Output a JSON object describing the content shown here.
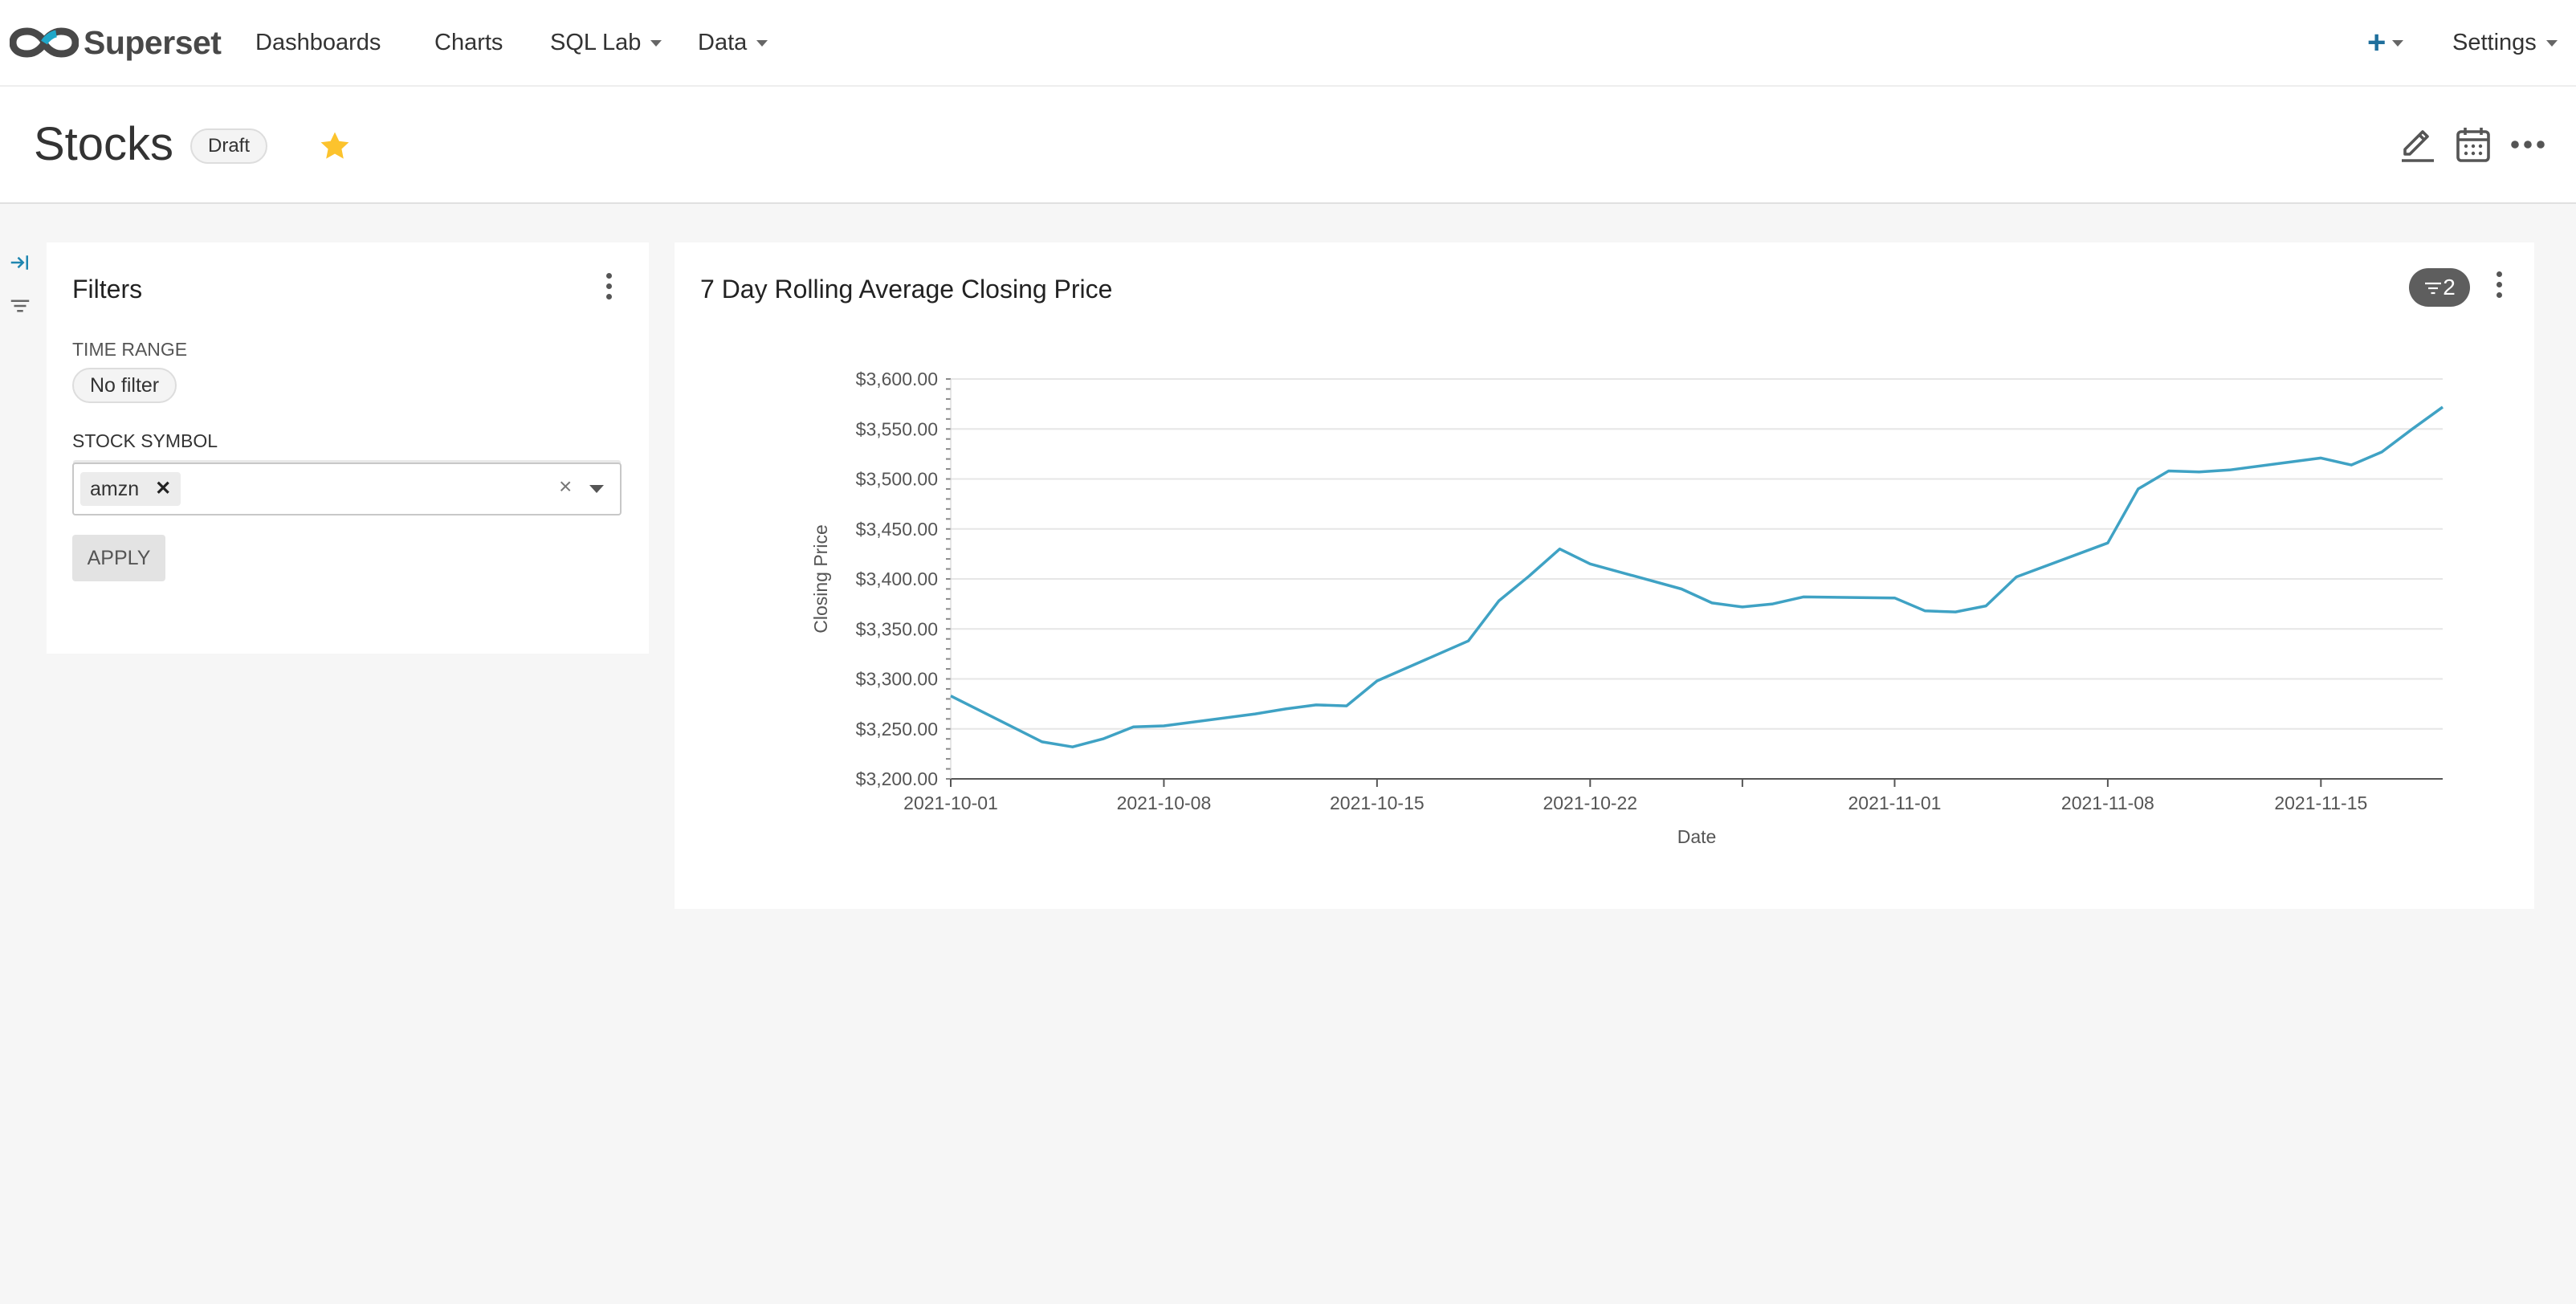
{
  "nav": {
    "brand": "Superset",
    "items": [
      {
        "label": "Dashboards"
      },
      {
        "label": "Charts"
      },
      {
        "label": "SQL Lab"
      },
      {
        "label": "Data"
      }
    ],
    "settings_label": "Settings"
  },
  "header": {
    "title": "Stocks",
    "badge": "Draft"
  },
  "filters": {
    "title": "Filters",
    "time_range_label": "TIME RANGE",
    "time_range_value": "No filter",
    "symbol_label": "STOCK SYMBOL",
    "symbol_selected": "amzn",
    "apply_label": "APPLY"
  },
  "chart": {
    "title": "7 Day Rolling Average Closing Price",
    "filter_count": "2"
  },
  "chart_data": {
    "type": "line",
    "xlabel": "Date",
    "ylabel": "Closing Price",
    "ylim": [
      3200,
      3600
    ],
    "xlim": [
      "2021-10-01",
      "2021-11-19"
    ],
    "grid": true,
    "color": "#3fa2c4",
    "x_ticks": [
      "2021-10-01",
      "2021-10-08",
      "2021-10-15",
      "2021-10-22",
      "2021-11-01",
      "2021-11-08",
      "2021-11-15"
    ],
    "y_ticks": [
      "$3,200.00",
      "$3,250.00",
      "$3,300.00",
      "$3,350.00",
      "$3,400.00",
      "$3,450.00",
      "$3,500.00",
      "$3,550.00",
      "$3,600.00"
    ],
    "series": [
      {
        "x": [
          "2021-10-01",
          "2021-10-04",
          "2021-10-05",
          "2021-10-06",
          "2021-10-07",
          "2021-10-08",
          "2021-10-11",
          "2021-10-12",
          "2021-10-13",
          "2021-10-14",
          "2021-10-15",
          "2021-10-18",
          "2021-10-19",
          "2021-10-20",
          "2021-10-21",
          "2021-10-22",
          "2021-10-25",
          "2021-10-26",
          "2021-10-27",
          "2021-10-28",
          "2021-10-29",
          "2021-11-01",
          "2021-11-02",
          "2021-11-03",
          "2021-11-04",
          "2021-11-05",
          "2021-11-08",
          "2021-11-09",
          "2021-11-10",
          "2021-11-11",
          "2021-11-12",
          "2021-11-15",
          "2021-11-16",
          "2021-11-17",
          "2021-11-18",
          "2021-11-19"
        ],
        "y": [
          3283,
          3237,
          3232,
          3240,
          3252,
          3253,
          3265,
          3270,
          3274,
          3273,
          3298,
          3338,
          3378,
          3403,
          3430,
          3415,
          3390,
          3376,
          3372,
          3375,
          3382,
          3381,
          3368,
          3367,
          3373,
          3402,
          3436,
          3490,
          3508,
          3507,
          3509,
          3521,
          3514,
          3527,
          3550,
          3572
        ]
      }
    ]
  }
}
